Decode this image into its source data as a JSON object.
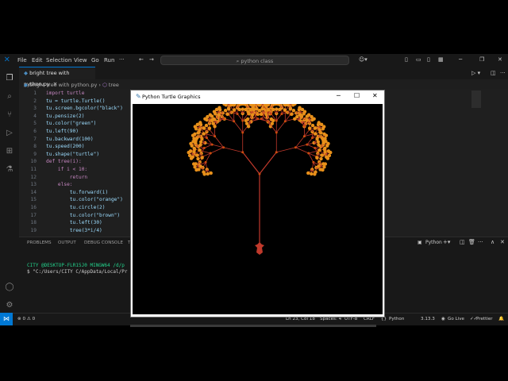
{
  "menu": [
    "File",
    "Edit",
    "Selection",
    "View",
    "Go",
    "Run"
  ],
  "command_center": {
    "text": "python class"
  },
  "tab": {
    "label": "bright tree with python.py"
  },
  "breadcrumb": {
    "file": "bright tree with python.py",
    "symbol": "tree"
  },
  "editor": {
    "line_numbers": [
      "1",
      "2",
      "3",
      "4",
      "5",
      "6",
      "7",
      "8",
      "9",
      "10",
      "11",
      "12",
      "13",
      "14",
      "15",
      "16",
      "17",
      "18",
      "19"
    ],
    "lines": [
      "import turtle",
      "tu = turtle.Turtle()",
      "tu.screen.bgcolor(\"black\")",
      "tu.pensize(2)",
      "tu.color(\"green\")",
      "tu.left(90)",
      "tu.backward(100)",
      "tu.speed(200)",
      "tu.shape(\"turtle\")",
      "def tree(i):",
      "    if i < 10:",
      "        return",
      "    else:",
      "        tu.forward(i)",
      "        tu.color(\"orange\")",
      "        tu.circle(2)",
      "        tu.color(\"brown\")",
      "        tu.left(30)",
      "        tree(3*i/4)"
    ]
  },
  "panel": {
    "tabs": [
      "PROBLEMS",
      "OUTPUT",
      "DEBUG CONSOLE",
      "T"
    ],
    "terminal_name": "Python",
    "prompt": "CITY @DESKTOP-FLR15J0 MINGW64 /d/p",
    "command": "$ \"C:/Users/CITY C/AppData/Local/Pr"
  },
  "statusbar": {
    "errors": "0",
    "warnings": "0",
    "position": "Ln 23, Col 18",
    "spaces": "Spaces: 4",
    "encoding": "UTF-8",
    "eol": "CRLF",
    "language": "Python",
    "version": "3.13.3",
    "golive": "Go Live",
    "prettier": "Prettier"
  },
  "turtle_window": {
    "title": "Python Turtle Graphics"
  },
  "colors": {
    "accent": "#0078d4",
    "branch": "#c0392b",
    "leaf": "#e8901a"
  },
  "tree": {
    "depth_start": 100,
    "min": 10,
    "angle": 30
  }
}
